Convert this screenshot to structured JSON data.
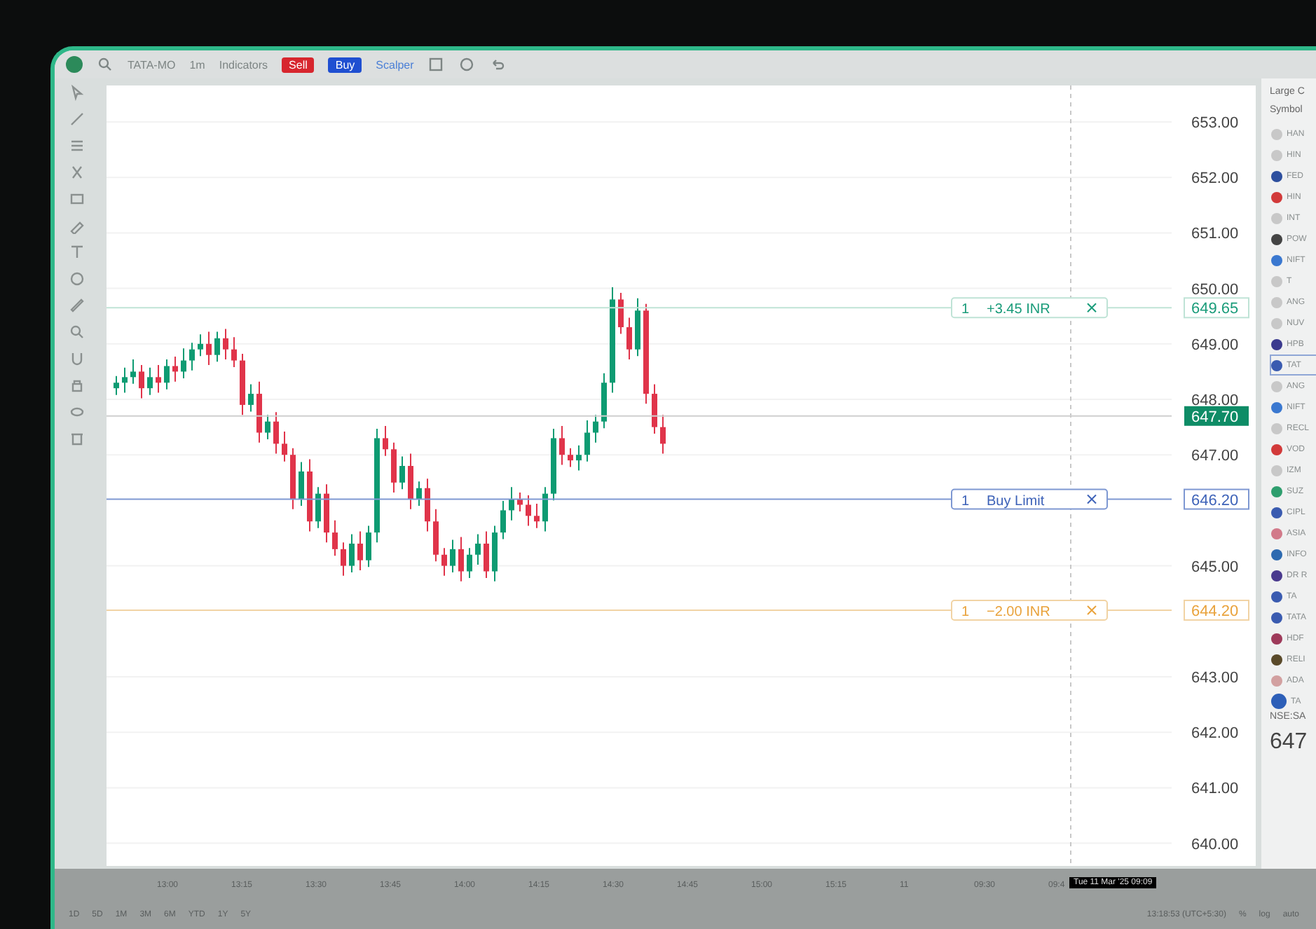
{
  "toolbar": {
    "symbol": "TATA-MO",
    "interval": "1m",
    "indicators": "Indicators",
    "sell": "Sell",
    "buy": "Buy",
    "scalper": "Scalper"
  },
  "chart": {
    "price_labels": [
      "653.00",
      "652.00",
      "651.00",
      "650.00",
      "649.00",
      "648.00",
      "647.00",
      "645.00",
      "643.00",
      "642.00",
      "641.00",
      "640.00"
    ],
    "current_price": "647.70",
    "orders": [
      {
        "kind": "profit",
        "qty": "1",
        "label": "+3.45 INR",
        "price": "649.65"
      },
      {
        "kind": "entry",
        "qty": "1",
        "label": "Buy Limit",
        "price": "646.20"
      },
      {
        "kind": "loss",
        "qty": "1",
        "label": "−2.00 INR",
        "price": "644.20"
      }
    ],
    "time_labels": [
      "13:00",
      "13:15",
      "13:30",
      "13:45",
      "14:00",
      "14:15",
      "14:30",
      "14:45",
      "15:00",
      "15:15",
      "11",
      "09:30",
      "09:4"
    ],
    "cursor_time": "Tue 11 Mar '25  09:09"
  },
  "range_bar": {
    "ranges": [
      "1D",
      "5D",
      "1M",
      "3M",
      "6M",
      "YTD",
      "1Y",
      "5Y"
    ],
    "time": "13:18:53 (UTC+5:30)",
    "scale": [
      "%",
      "log",
      "auto"
    ]
  },
  "watchlist": {
    "title": "Large C",
    "column": "Symbol",
    "items": [
      {
        "symbol": "HAN",
        "color": "#c8c8c8"
      },
      {
        "symbol": "HIN",
        "color": "#c8c8c8"
      },
      {
        "symbol": "FED",
        "color": "#2d4f9e"
      },
      {
        "symbol": "HIN",
        "color": "#d23a3a"
      },
      {
        "symbol": "INT",
        "color": "#c8c8c8"
      },
      {
        "symbol": "POW",
        "color": "#444444"
      },
      {
        "symbol": "NIFT",
        "color": "#3a78d0"
      },
      {
        "symbol": "T",
        "color": "#c8c8c8"
      },
      {
        "symbol": "ANG",
        "color": "#c8c8c8"
      },
      {
        "symbol": "NUV",
        "color": "#c8c8c8"
      },
      {
        "symbol": "HPB",
        "color": "#3b3a8e"
      },
      {
        "symbol": "TAT",
        "color": "#3a5bb0"
      },
      {
        "symbol": "ANG",
        "color": "#c8c8c8"
      },
      {
        "symbol": "NIFT",
        "color": "#3a78d0"
      },
      {
        "symbol": "RECL",
        "color": "#c8c8c8"
      },
      {
        "symbol": "VOD",
        "color": "#d23a3a"
      },
      {
        "symbol": "IZM",
        "color": "#c8c8c8"
      },
      {
        "symbol": "SUZ",
        "color": "#2e9e6e"
      },
      {
        "symbol": "CIPL",
        "color": "#3a5bb0"
      },
      {
        "symbol": "ASIA",
        "color": "#d27a8a"
      },
      {
        "symbol": "INFO",
        "color": "#2d6ab0"
      },
      {
        "symbol": "DR R",
        "color": "#4a3a8e"
      },
      {
        "symbol": "TA",
        "color": "#3a5bb0"
      },
      {
        "symbol": "TATA",
        "color": "#3a5bb0"
      },
      {
        "symbol": "HDF",
        "color": "#9e3a5a"
      },
      {
        "symbol": "RELI",
        "color": "#5a4a2a"
      },
      {
        "symbol": "ADA",
        "color": "#d2a0a0"
      }
    ],
    "selected_symbol": "TA",
    "exchange": "NSE:SA",
    "price": "647"
  }
}
